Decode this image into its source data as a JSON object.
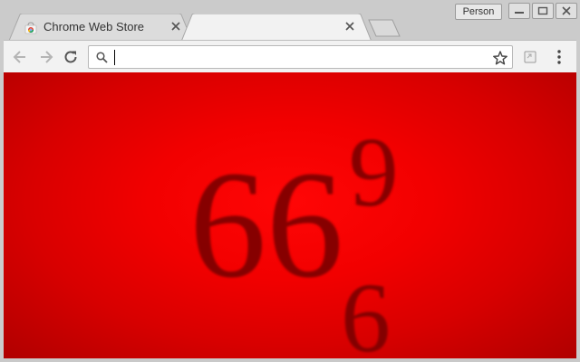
{
  "window": {
    "profile_label": "Person",
    "controls": [
      "minimize-icon",
      "maximize-icon",
      "close-icon"
    ]
  },
  "tabs": [
    {
      "title": "Chrome Web Store",
      "icon": "chrome-web-store-icon",
      "active": false
    },
    {
      "title": "",
      "icon": "",
      "active": true
    }
  ],
  "toolbar": {
    "omnibox": {
      "value": "",
      "placeholder": ""
    },
    "icons": [
      "back-arrow-icon",
      "forward-arrow-icon",
      "reload-icon",
      "search-icon",
      "star-icon",
      "extension-icon",
      "menu-dots-icon"
    ]
  },
  "content": {
    "theme_glyphs": "66",
    "theme_glyph_small": "6",
    "colors": {
      "background": "#e80000",
      "glyph": "#7a0000"
    }
  }
}
